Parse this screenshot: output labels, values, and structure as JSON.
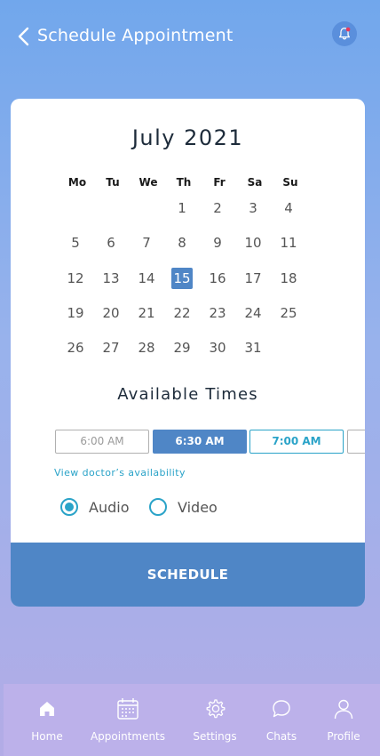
{
  "header": {
    "title": "Schedule Appointment",
    "back_icon": "chevron-left-icon",
    "bell_icon": "bell-icon"
  },
  "calendar": {
    "month_label": "July 2021",
    "weekdays": [
      "Mo",
      "Tu",
      "We",
      "Th",
      "Fr",
      "Sa",
      "Su"
    ],
    "weeks": [
      [
        "",
        "",
        "",
        "1",
        "2",
        "3",
        "4"
      ],
      [
        "5",
        "6",
        "7",
        "8",
        "9",
        "10",
        "11"
      ],
      [
        "12",
        "13",
        "14",
        "15",
        "16",
        "17",
        "18"
      ],
      [
        "19",
        "20",
        "21",
        "22",
        "23",
        "24",
        "25"
      ],
      [
        "26",
        "27",
        "28",
        "29",
        "30",
        "31",
        ""
      ]
    ],
    "selected_day": "15"
  },
  "times": {
    "title": "Available Times",
    "slots": [
      {
        "label": "6:00 AM",
        "state": "disabled"
      },
      {
        "label": "6:30 AM",
        "state": "selected"
      },
      {
        "label": "7:00 AM",
        "state": "available"
      }
    ],
    "view_link": "View doctor’s availability"
  },
  "call_type": {
    "options": [
      {
        "label": "Audio",
        "checked": true
      },
      {
        "label": "Video",
        "checked": false
      }
    ]
  },
  "schedule_button": "SCHEDULE",
  "nav": {
    "items": [
      {
        "label": "Home",
        "icon": "home-icon"
      },
      {
        "label": "Appointments",
        "icon": "calendar-icon"
      },
      {
        "label": "Settings",
        "icon": "gear-icon"
      },
      {
        "label": "Chats",
        "icon": "chat-icon"
      },
      {
        "label": "Profile",
        "icon": "user-icon"
      }
    ]
  },
  "colors": {
    "accent": "#4f86c6",
    "link": "#2aa3c8",
    "notification_dot": "#e8395c"
  }
}
